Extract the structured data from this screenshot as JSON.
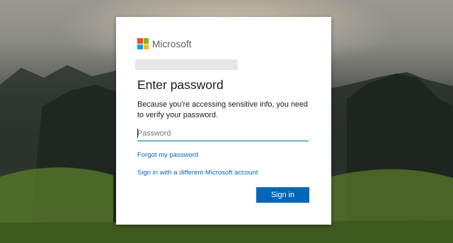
{
  "brand": {
    "name": "Microsoft",
    "logo_colors": [
      "#f25022",
      "#7fba00",
      "#00a4ef",
      "#ffb900"
    ]
  },
  "form": {
    "title": "Enter password",
    "description": "Because you're accessing sensitive info, you need to verify your password.",
    "password_placeholder": "Password",
    "password_value": "",
    "forgot_link": "Forgot my password",
    "other_account_link": "Sign in with a different Microsoft account",
    "submit_label": "Sign in"
  },
  "colors": {
    "accent": "#0067b8",
    "card_background": "#ffffff"
  }
}
